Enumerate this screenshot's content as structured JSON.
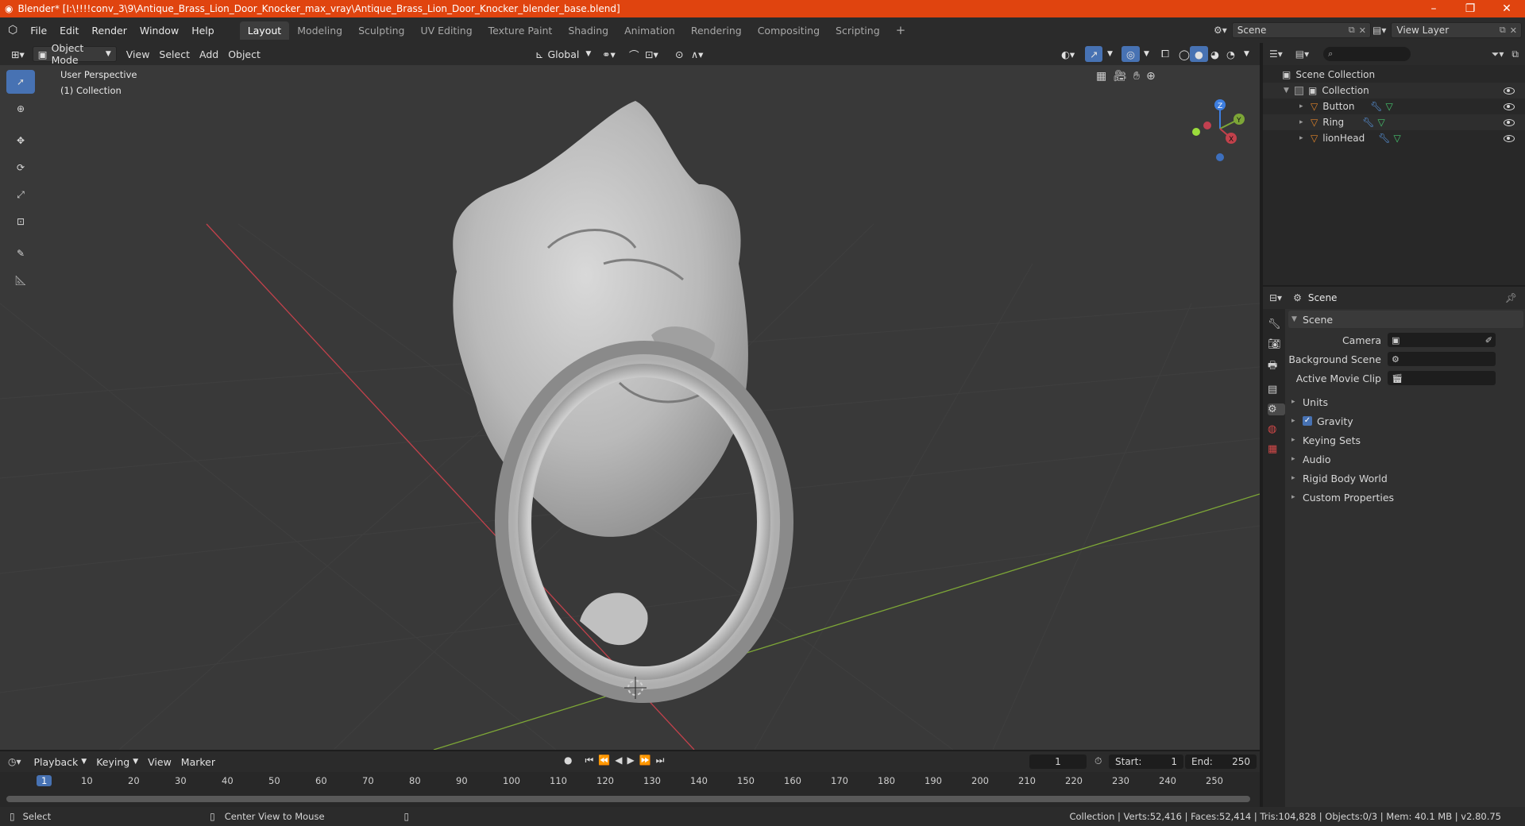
{
  "titlebar": {
    "title": "Blender* [I:\\!!!!conv_3\\9\\Antique_Brass_Lion_Door_Knocker_max_vray\\Antique_Brass_Lion_Door_Knocker_blender_base.blend]",
    "minimize": "–",
    "maximize": "❐",
    "close": "✕"
  },
  "menu": {
    "items": [
      "File",
      "Edit",
      "Render",
      "Window",
      "Help"
    ]
  },
  "workspaces": {
    "tabs": [
      "Layout",
      "Modeling",
      "Sculpting",
      "UV Editing",
      "Texture Paint",
      "Shading",
      "Animation",
      "Rendering",
      "Compositing",
      "Scripting"
    ],
    "add": "+"
  },
  "scene": {
    "name": "Scene"
  },
  "view_layer": {
    "name": "View Layer"
  },
  "viewport_header": {
    "mode": "Object Mode",
    "view": "View",
    "select": "Select",
    "add": "Add",
    "object": "Object",
    "orientation": "Global"
  },
  "viewport": {
    "perspective": "User Perspective",
    "collection": "(1) Collection"
  },
  "gizmo": {
    "z": "Z",
    "y": "Y",
    "x": "X"
  },
  "outliner": {
    "root": "Scene Collection",
    "collection": "Collection",
    "objects": [
      "Button",
      "Ring",
      "lionHead"
    ]
  },
  "properties": {
    "context": "Scene",
    "panel": "Scene",
    "camera_label": "Camera",
    "bg_scene_label": "Background Scene",
    "movie_clip_label": "Active Movie Clip",
    "sections": [
      "Units",
      "Gravity",
      "Keying Sets",
      "Audio",
      "Rigid Body World",
      "Custom Properties"
    ]
  },
  "timeline": {
    "playback": "Playback",
    "keying": "Keying",
    "view": "View",
    "marker": "Marker",
    "current_frame": "1",
    "start_label": "Start:",
    "start": "1",
    "end_label": "End:",
    "end": "250",
    "ruler": [
      "1",
      "10",
      "20",
      "30",
      "40",
      "50",
      "60",
      "70",
      "80",
      "90",
      "100",
      "110",
      "120",
      "130",
      "140",
      "150",
      "160",
      "170",
      "180",
      "190",
      "200",
      "210",
      "220",
      "230",
      "240",
      "250"
    ]
  },
  "statusbar": {
    "select": "Select",
    "center_view": "Center View to Mouse",
    "stats": "Collection | Verts:52,416 | Faces:52,414 | Tris:104,828 | Objects:0/3 | Mem: 40.1 MB | v2.80.75"
  },
  "colors": {
    "accent": "#4772b3",
    "title_bar": "#e0440f",
    "x_axis": "#c2414b",
    "y_axis": "#7da637",
    "z_axis": "#3d7ee0"
  }
}
